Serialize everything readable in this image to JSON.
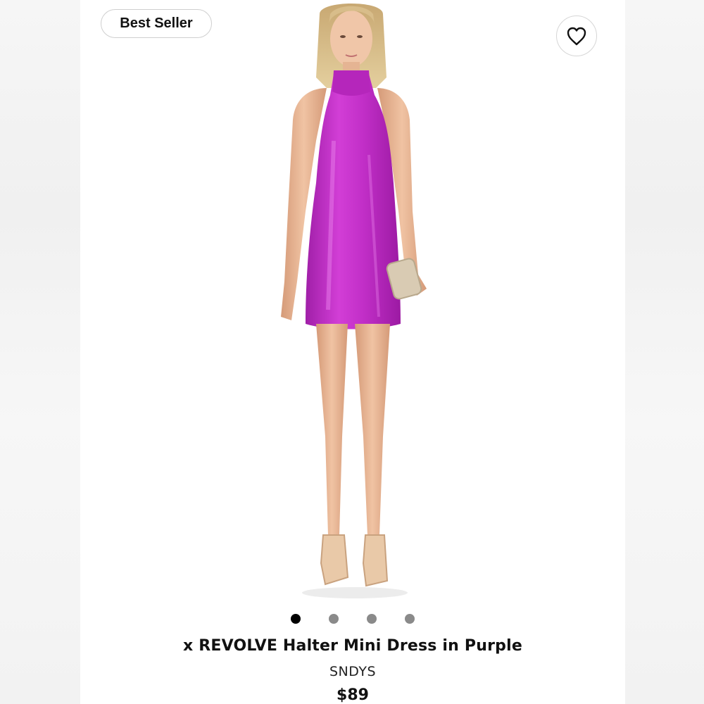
{
  "product": {
    "badge_label": "Best Seller",
    "title": "x REVOLVE Halter Mini Dress in Purple",
    "brand": "SNDYS",
    "price": "$89",
    "favorite_icon": "heart-icon",
    "image": {
      "subject": "model wearing purple satin halter mini dress",
      "dress_color": "#c22fc8",
      "count": 4,
      "active_index": 0
    }
  },
  "colors": {
    "active_dot": "#000000",
    "inactive_dot": "#8a8a8a",
    "card_bg": "#ffffff",
    "page_bg": "#f4f4f4"
  }
}
